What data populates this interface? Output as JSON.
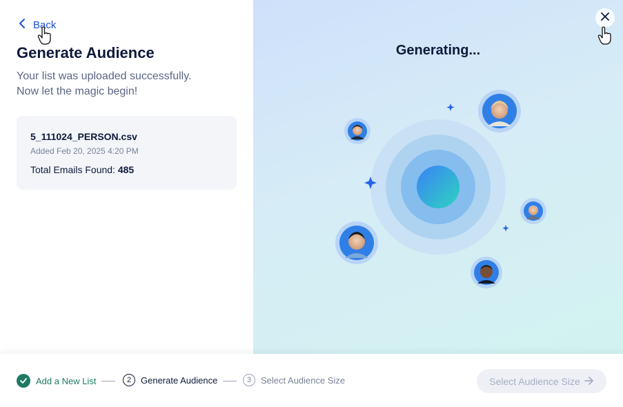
{
  "back": {
    "label": "Back"
  },
  "header": {
    "title": "Generate Audience",
    "subtitle_line1": "Your list was uploaded successfully.",
    "subtitle_line2": "Now let the magic begin!"
  },
  "file_card": {
    "name": "5_111024_PERSON.csv",
    "added": "Added Feb 20, 2025 4:20 PM",
    "total_label": "Total Emails Found:",
    "total_value": "485"
  },
  "generating": {
    "title": "Generating..."
  },
  "steps": [
    {
      "number": "1",
      "label": "Add a New List",
      "status": "complete"
    },
    {
      "number": "2",
      "label": "Generate Audience",
      "status": "current"
    },
    {
      "number": "3",
      "label": "Select Audience Size",
      "status": "upcoming"
    }
  ],
  "cta": {
    "label": "Select Audience Size",
    "disabled": true
  },
  "icons": {
    "back": "chevron-left-icon",
    "close": "close-icon",
    "check": "check-icon",
    "arrow": "arrow-right-icon",
    "sparkle": "sparkle-icon"
  },
  "colors": {
    "accent": "#1d4ed8",
    "success": "#1f7a63",
    "text": "#0f1a3a",
    "muted": "#5b6585"
  }
}
